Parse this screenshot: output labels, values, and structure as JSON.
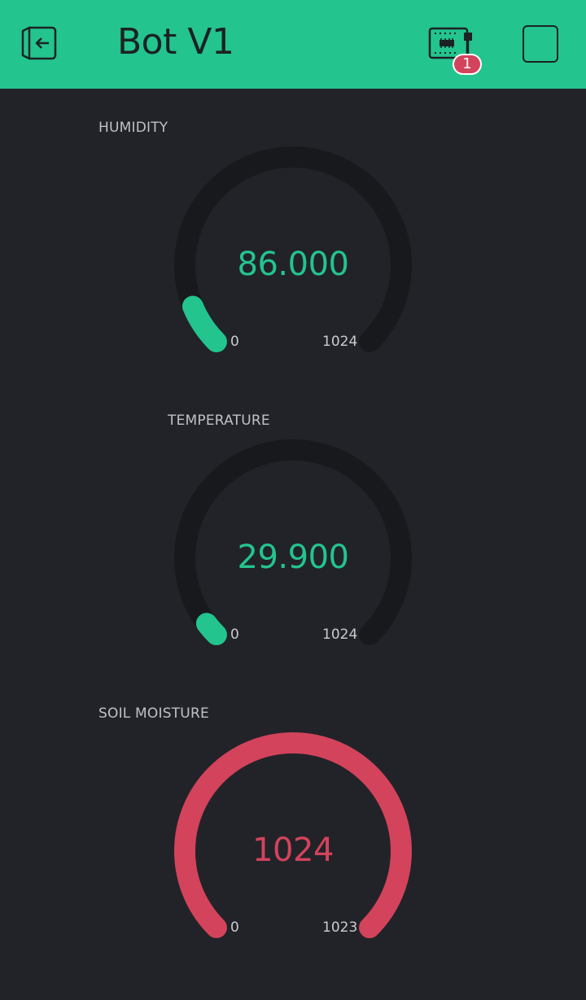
{
  "header": {
    "title": "Bot V1",
    "device_badge_count": "1",
    "back_icon": "exit-icon",
    "device_icon": "hardware-board-icon",
    "stop_icon": "stop-square-icon"
  },
  "colors": {
    "header_bg": "#23c48e",
    "background": "#222328",
    "gauge_track": "#18191c",
    "green": "#23c48e",
    "red": "#d3435c"
  },
  "gauges": [
    {
      "label": "HUMIDITY",
      "value": "86.000",
      "value_num": 86.0,
      "min": "0",
      "max": "1024",
      "min_num": 0,
      "max_num": 1024,
      "color": "#23c48e"
    },
    {
      "label": "TEMPERATURE",
      "value": "29.900",
      "value_num": 29.9,
      "min": "0",
      "max": "1024",
      "min_num": 0,
      "max_num": 1024,
      "color": "#23c48e"
    },
    {
      "label": "SOIL MOISTURE",
      "value": "1024",
      "value_num": 1024,
      "min": "0",
      "max": "1023",
      "min_num": 0,
      "max_num": 1023,
      "color": "#d3435c"
    }
  ]
}
